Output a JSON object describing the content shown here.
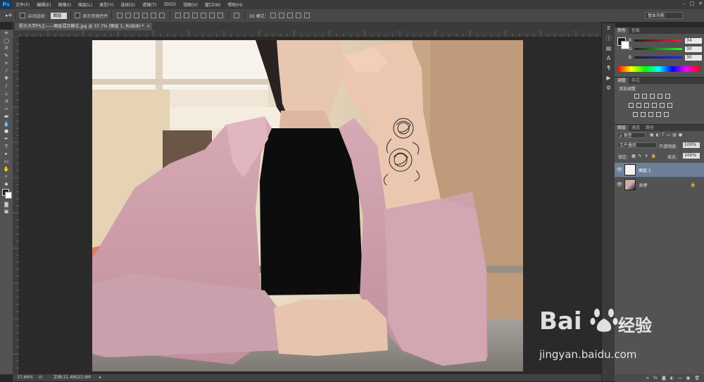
{
  "menu": {
    "logo": "Ps",
    "items": [
      "文件(F)",
      "编辑(E)",
      "图像(I)",
      "图层(L)",
      "类型(Y)",
      "选择(S)",
      "滤镜(T)",
      "3D(D)",
      "视图(V)",
      "窗口(W)",
      "帮助(H)"
    ]
  },
  "options": {
    "auto_select_label": "自动选择：",
    "auto_select_value": "图层",
    "show_transform_label": "显示变换控件",
    "mode_3d_label": "3D 模式：",
    "workspace": "基本功能"
  },
  "document": {
    "tab_title": "程大大学PS之——图层混合模式.jpg @ 37.7% (图层 1, RGB/8) *",
    "close": "×"
  },
  "status": {
    "zoom": "37.66%",
    "doc_info": "文档:21.4M/23.9M"
  },
  "color_panel": {
    "tabs": [
      "颜色",
      "色板"
    ],
    "r_label": "R",
    "g_label": "G",
    "b_label": "B",
    "r_value": "34",
    "g_value": "30",
    "b_value": "30"
  },
  "adjust_panel": {
    "tabs": [
      "调整",
      "样式"
    ],
    "title": "添加调整"
  },
  "layers_panel": {
    "tabs": [
      "图层",
      "通道",
      "路径"
    ],
    "filter_label": "ρ 类型",
    "blend_mode": "正片叠底",
    "opacity_label": "不透明度:",
    "opacity_value": "100%",
    "lock_label": "锁定:",
    "fill_label": "填充:",
    "fill_value": "100%",
    "layers": [
      {
        "name": "图层 1",
        "selected": true
      },
      {
        "name": "背景",
        "selected": false
      }
    ]
  },
  "watermark": {
    "brand": "Bai",
    "brand_suffix": "经验",
    "url": "jingyan.baidu.com"
  },
  "colors": {
    "accent": "#31a8ff",
    "selection": "#6d7f99"
  }
}
